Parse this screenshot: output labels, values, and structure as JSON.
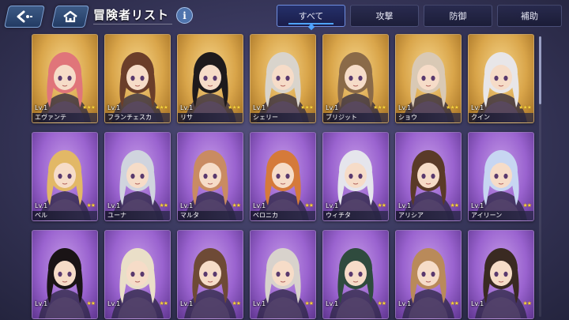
{
  "header": {
    "title": "冒険者リスト",
    "info_label": "i"
  },
  "tabs": [
    {
      "label": "すべて",
      "active": true
    },
    {
      "label": "攻撃",
      "active": false
    },
    {
      "label": "防御",
      "active": false
    },
    {
      "label": "補助",
      "active": false
    }
  ],
  "icons": {
    "back": "back-arrow-icon",
    "home": "home-icon",
    "info": "info-icon"
  },
  "colors": {
    "gold_card": "#d9a54a",
    "purple_card": "#9a63cf",
    "tab_active_accent": "#4fa3ff",
    "star": "#f4d03f"
  },
  "characters": [
    {
      "name": "エヴァンテ",
      "level": "Lv.1",
      "stars": "★★★",
      "frame": "gold",
      "hair": "#e0757a"
    },
    {
      "name": "フランチェスカ",
      "level": "Lv.1",
      "stars": "★★★",
      "frame": "gold",
      "hair": "#6b3e2a"
    },
    {
      "name": "リサ",
      "level": "Lv.1",
      "stars": "★★★",
      "frame": "gold",
      "hair": "#1e1a1c"
    },
    {
      "name": "シェリー",
      "level": "Lv.1",
      "stars": "★★★",
      "frame": "gold",
      "hair": "#d9d4cc"
    },
    {
      "name": "ブリジット",
      "level": "Lv.1",
      "stars": "★★★",
      "frame": "gold",
      "hair": "#8a6a48"
    },
    {
      "name": "ショウ",
      "level": "Lv.1",
      "stars": "★★★",
      "frame": "gold",
      "hair": "#d9c9b5"
    },
    {
      "name": "クイン",
      "level": "Lv.1",
      "stars": "★★★",
      "frame": "gold",
      "hair": "#e8e6e8"
    },
    {
      "name": "ベル",
      "level": "Lv.1",
      "stars": "★★",
      "frame": "purple",
      "hair": "#e2b866"
    },
    {
      "name": "ユーナ",
      "level": "Lv.1",
      "stars": "★★",
      "frame": "purple",
      "hair": "#d0d4de"
    },
    {
      "name": "マルタ",
      "level": "Lv.1",
      "stars": "★★",
      "frame": "purple",
      "hair": "#c98b62"
    },
    {
      "name": "ベロニカ",
      "level": "Lv.1",
      "stars": "★★",
      "frame": "purple",
      "hair": "#d57a3a"
    },
    {
      "name": "ウィチタ",
      "level": "Lv.1",
      "stars": "★★",
      "frame": "purple",
      "hair": "#e5e5ec"
    },
    {
      "name": "アリシア",
      "level": "Lv.1",
      "stars": "★★",
      "frame": "purple",
      "hair": "#5a3a28"
    },
    {
      "name": "アイリーン",
      "level": "Lv.1",
      "stars": "★★",
      "frame": "purple",
      "hair": "#c7d6f2"
    },
    {
      "name": "",
      "level": "Lv.1",
      "stars": "★★",
      "frame": "purple",
      "hair": "#1a1416"
    },
    {
      "name": "",
      "level": "Lv.1",
      "stars": "★★",
      "frame": "purple",
      "hair": "#eadfc8"
    },
    {
      "name": "",
      "level": "Lv.1",
      "stars": "★★",
      "frame": "purple",
      "hair": "#6e4a36"
    },
    {
      "name": "",
      "level": "Lv.1",
      "stars": "★★",
      "frame": "purple",
      "hair": "#d8d2cc"
    },
    {
      "name": "",
      "level": "Lv.1",
      "stars": "★★",
      "frame": "purple",
      "hair": "#2f4b3e"
    },
    {
      "name": "",
      "level": "Lv.1",
      "stars": "★★",
      "frame": "purple",
      "hair": "#b98a5a"
    },
    {
      "name": "",
      "level": "Lv.1",
      "stars": "★★",
      "frame": "purple",
      "hair": "#3a2a22"
    }
  ]
}
